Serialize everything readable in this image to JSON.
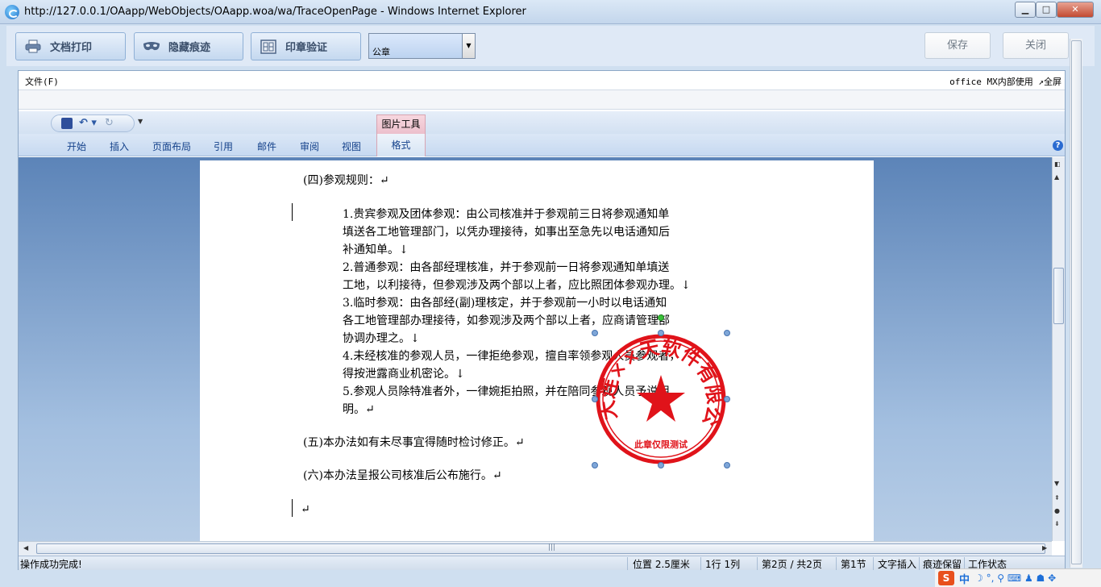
{
  "window": {
    "title": "http://127.0.0.1/OAapp/WebObjects/OAapp.woa/wa/TraceOpenPage - Windows Internet Explorer",
    "min": "▁",
    "max": "□",
    "close": "✕"
  },
  "toolbar": {
    "print_label": "文档打印",
    "hide_trace_label": "隐藏痕迹",
    "seal_verify_label": "印章验证",
    "seal_select_value": "公章",
    "save_label": "保存",
    "close_label": "关闭"
  },
  "office": {
    "file_menu": "文件(F)",
    "right_info": "office MX内部使用",
    "fullscreen": "↗全屏",
    "context_tab_header": "图片工具",
    "tabs": [
      "开始",
      "插入",
      "页面布局",
      "引用",
      "邮件",
      "审阅",
      "视图",
      "格式"
    ],
    "help": "?"
  },
  "document": {
    "heading4": "(四)参观规则：↵",
    "items": [
      "1.贵宾参观及团体参观：由公司核准并于参观前三日将参观通知单",
      "填送各工地管理部门，以凭办理接待，如事出至急先以电话通知后",
      "补通知单。↓",
      "2.普通参观：由各部经理核准，并于参观前一日将参观通知单填送",
      "工地，以利接待，但参观涉及两个部以上者，应比照团体参观办理。↓",
      "3.临时参观：由各部经(副)理核定，并于参观前一小时以电话通知",
      "各工地管理部办理接待，如参观涉及两个部以上者，应商请管理部",
      "协调办理之。↓",
      "4.未经核准的参观人员，一律拒绝参观，擅自率领参观人员参观者，",
      "得按泄露商业机密论。↓",
      "5.参观人员除特准者外，一律婉拒拍照，并在陪同参观人员予说明",
      "明。↵"
    ],
    "heading5": "(五)本办法如有未尽事宜得随时检讨修正。↵",
    "heading6": "(六)本办法呈报公司核准后公布施行。↵",
    "empty_para": "↵",
    "stamp": {
      "ring_text": "大连××天软件有限公司",
      "bottom_text": "此章仅限测试",
      "color": "#e0131a"
    }
  },
  "status": {
    "message": "操作成功完成!",
    "position": "位置 2.5厘米",
    "line_col": "1行 1列",
    "page": "第2页 / 共2页",
    "section": "第1节",
    "insert_mode": "文字插入",
    "track_mode": "痕迹保留",
    "work_state": "工作状态"
  },
  "ime": {
    "logo": "S",
    "lang": "中",
    "icons": "☽ °, ⚲ ⌨ ♟ ☗ ✥"
  }
}
